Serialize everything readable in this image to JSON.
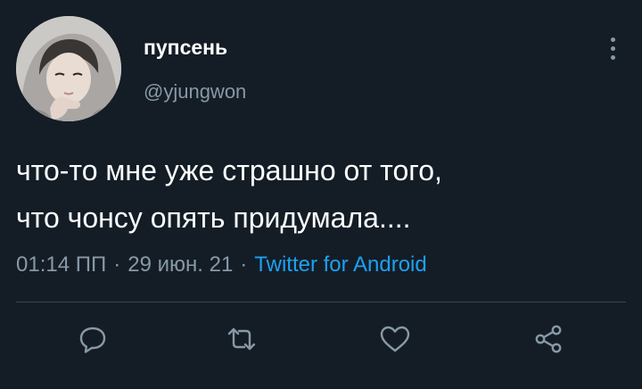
{
  "tweet": {
    "display_name": "пупсень",
    "handle": "@yjungwon",
    "text_lines": [
      "что-то мне уже страшно от того,",
      "что чонсу опять придумала...."
    ],
    "time": "01:14 ПП",
    "date": "29 июн. 21",
    "separator": "·",
    "source": "Twitter for Android"
  },
  "icons": {
    "more": "more-vertical-icon",
    "reply": "reply-icon",
    "retweet": "retweet-icon",
    "like": "heart-icon",
    "share": "share-icon"
  },
  "colors": {
    "background": "#141d26",
    "text": "#ffffff",
    "secondary_text": "#8899a6",
    "link": "#1da1f2",
    "divider": "#38444d"
  }
}
